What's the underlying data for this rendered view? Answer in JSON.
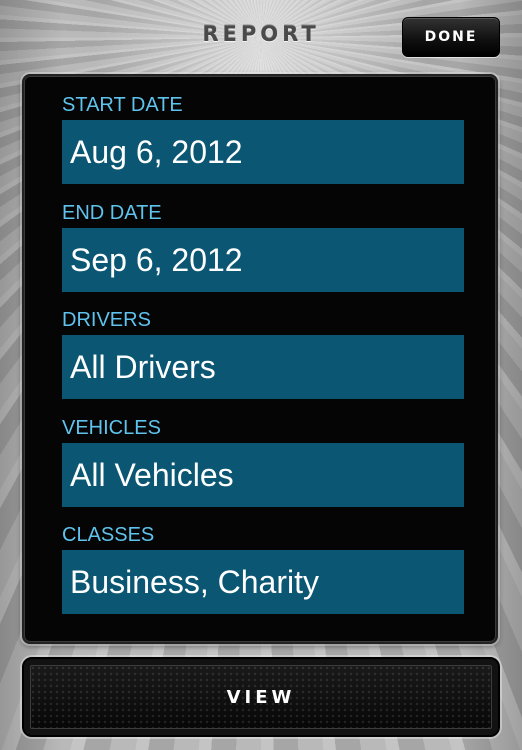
{
  "header": {
    "title": "REPORT",
    "done_label": "DONE"
  },
  "form": {
    "fields": [
      {
        "label": "START DATE",
        "value": "Aug 6, 2012"
      },
      {
        "label": "END DATE",
        "value": "Sep 6, 2012"
      },
      {
        "label": "DRIVERS",
        "value": "All Drivers"
      },
      {
        "label": "VEHICLES",
        "value": "All Vehicles"
      },
      {
        "label": "CLASSES",
        "value": "Business, Charity"
      }
    ]
  },
  "footer": {
    "view_label": "VIEW"
  },
  "colors": {
    "label": "#5fc3ee",
    "field_background": "#0a5673",
    "panel_background": "#050505"
  }
}
